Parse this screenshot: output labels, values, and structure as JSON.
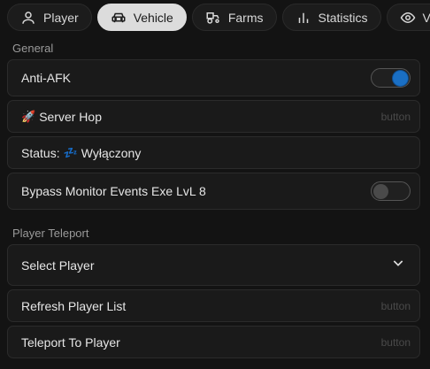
{
  "tabs": [
    {
      "label": "Player",
      "icon": "user-icon",
      "active": false
    },
    {
      "label": "Vehicle",
      "icon": "car-icon",
      "active": true
    },
    {
      "label": "Farms",
      "icon": "tractor-icon",
      "active": false
    },
    {
      "label": "Statistics",
      "icon": "bar-chart-icon",
      "active": false
    },
    {
      "label": "Visu",
      "icon": "eye-icon",
      "active": false
    }
  ],
  "general": {
    "section_label": "General",
    "anti_afk": {
      "label": "Anti-AFK",
      "enabled": true
    },
    "server_hop": {
      "emoji": "🚀",
      "label": "Server Hop",
      "hint": "button"
    },
    "status": {
      "prefix": "Status:",
      "emoji": "💤",
      "value": "Wyłączony"
    },
    "bypass": {
      "label": "Bypass Monitor Events Exe LvL 8",
      "enabled": false
    }
  },
  "teleport": {
    "section_label": "Player Teleport",
    "select_player": {
      "label": "Select Player"
    },
    "refresh": {
      "label": "Refresh Player List",
      "hint": "button"
    },
    "teleport_to": {
      "label": "Teleport To Player",
      "hint": "button"
    }
  },
  "colors": {
    "background": "#131313",
    "card": "#1a1a1a",
    "toggle_on": "#1a6fc4",
    "active_tab": "#dcdcdc"
  }
}
